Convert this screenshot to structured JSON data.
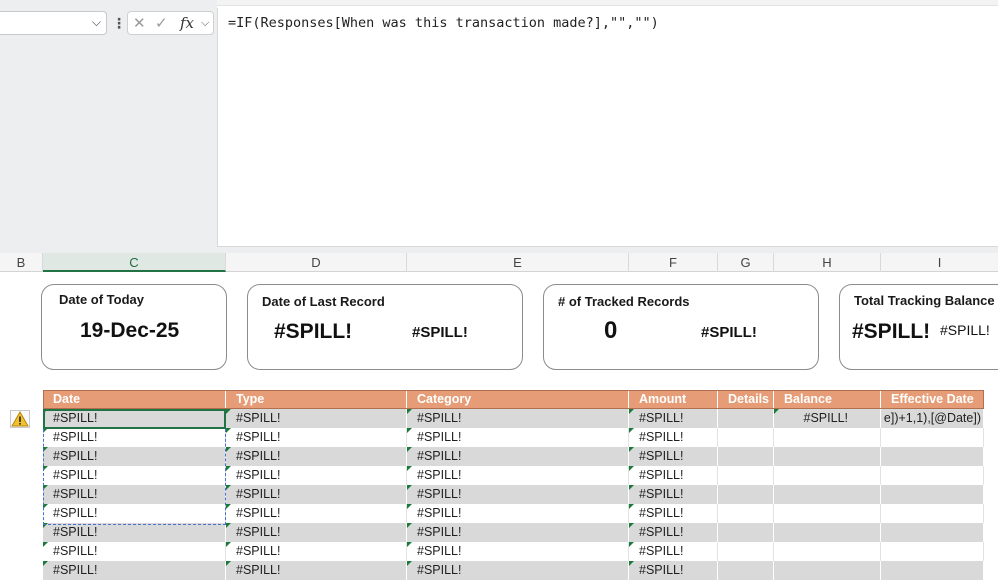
{
  "formula_bar": {
    "name_box_value": "",
    "formula": "=IF(Responses[When was this transaction made?],\"\",\"\")",
    "cancel_glyph": "✕",
    "enter_glyph": "✓",
    "fx_label": "fx"
  },
  "columns": [
    "B",
    "C",
    "D",
    "E",
    "F",
    "G",
    "H",
    "I"
  ],
  "cards": {
    "today": {
      "title": "Date of Today",
      "value": "19-Dec-25"
    },
    "last_record": {
      "title": "Date of Last Record",
      "value": "#SPILL!",
      "secondary": "#SPILL!"
    },
    "tracked": {
      "title": "# of Tracked Records",
      "value": "0",
      "secondary": "#SPILL!"
    },
    "balance": {
      "title": "Total Tracking Balance",
      "value": "#SPILL!",
      "secondary": "#SPILL!"
    }
  },
  "table": {
    "headers": [
      "Date",
      "Type",
      "Category",
      "Amount",
      "Details",
      "Balance",
      "Effective Date"
    ],
    "rows": [
      [
        "#SPILL!",
        "#SPILL!",
        "#SPILL!",
        "#SPILL!",
        "",
        "#SPILL!",
        "e])+1,1),[@Date])"
      ],
      [
        "#SPILL!",
        "#SPILL!",
        "#SPILL!",
        "#SPILL!",
        "",
        "",
        ""
      ],
      [
        "#SPILL!",
        "#SPILL!",
        "#SPILL!",
        "#SPILL!",
        "",
        "",
        ""
      ],
      [
        "#SPILL!",
        "#SPILL!",
        "#SPILL!",
        "#SPILL!",
        "",
        "",
        ""
      ],
      [
        "#SPILL!",
        "#SPILL!",
        "#SPILL!",
        "#SPILL!",
        "",
        "",
        ""
      ],
      [
        "#SPILL!",
        "#SPILL!",
        "#SPILL!",
        "#SPILL!",
        "",
        "",
        ""
      ],
      [
        "#SPILL!",
        "#SPILL!",
        "#SPILL!",
        "#SPILL!",
        "",
        "",
        ""
      ],
      [
        "#SPILL!",
        "#SPILL!",
        "#SPILL!",
        "#SPILL!",
        "",
        "",
        ""
      ],
      [
        "#SPILL!",
        "#SPILL!",
        "#SPILL!",
        "#SPILL!",
        "",
        "",
        ""
      ]
    ]
  },
  "colors": {
    "header_fill": "#e69d77",
    "band_fill": "#d9d9d9",
    "selection": "#217346",
    "error_indicator": "#1a7a3a"
  },
  "icons": {
    "warning": "warning-icon",
    "name_box_dropdown": "chevron-down-icon"
  }
}
